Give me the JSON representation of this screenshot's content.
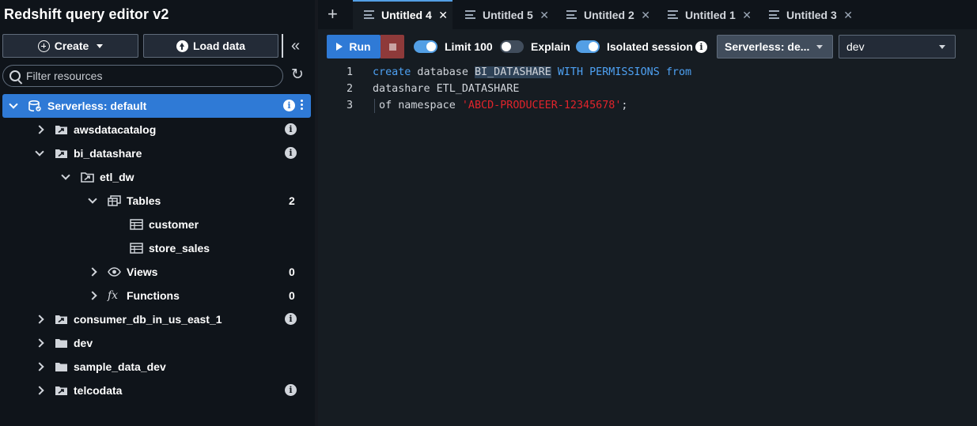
{
  "sidebar": {
    "title": "Redshift query editor v2",
    "create_label": "Create",
    "load_label": "Load data",
    "filter_placeholder": "Filter resources",
    "tree": [
      {
        "label": "Serverless: default"
      },
      {
        "label": "awsdatacatalog"
      },
      {
        "label": "bi_datashare"
      },
      {
        "label": "etl_dw"
      },
      {
        "label": "Tables",
        "count": "2"
      },
      {
        "label": "customer"
      },
      {
        "label": "store_sales"
      },
      {
        "label": "Views",
        "count": "0"
      },
      {
        "label": "Functions",
        "count": "0"
      },
      {
        "label": "consumer_db_in_us_east_1"
      },
      {
        "label": "dev"
      },
      {
        "label": "sample_data_dev"
      },
      {
        "label": "telcodata"
      }
    ]
  },
  "tabs": [
    {
      "label": "Untitled 4",
      "active": true
    },
    {
      "label": "Untitled 5"
    },
    {
      "label": "Untitled 2"
    },
    {
      "label": "Untitled 1"
    },
    {
      "label": "Untitled 3"
    }
  ],
  "toolbar": {
    "run_label": "Run",
    "limit_label": "Limit 100",
    "explain_label": "Explain",
    "isolated_label": "Isolated session",
    "connection_value": "Serverless: de...",
    "database_value": "dev"
  },
  "editor": {
    "line_numbers": [
      "1",
      "2",
      "3"
    ],
    "line1": {
      "kw1": "create",
      "t1": " database ",
      "hl": "BI_DATASHARE",
      "t2": " ",
      "kw2": "WITH PERMISSIONS from"
    },
    "line2": {
      "t1": "datashare ETL_DATASHARE"
    },
    "line3": {
      "t1": " of namespace ",
      "str": "'ABCD-PRODUCEER-12345678'",
      "t2": ";"
    }
  },
  "colors": {
    "accent": "#539fe5",
    "run": "#2f7ad6",
    "keyword": "#4ea1f3",
    "string": "#e0242b"
  }
}
